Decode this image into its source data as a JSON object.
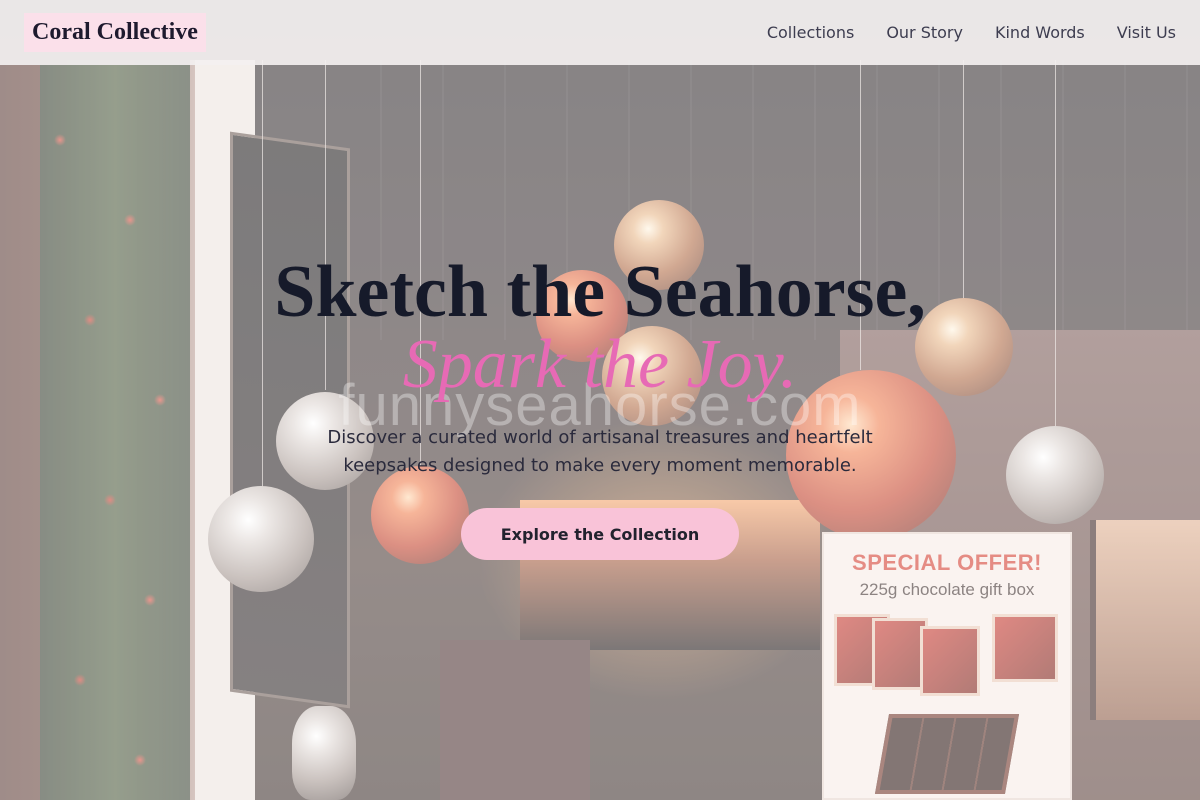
{
  "brand": {
    "name": "Coral Collective"
  },
  "nav": {
    "items": [
      "Collections",
      "Our Story",
      "Kind Words",
      "Visit Us"
    ]
  },
  "hero": {
    "title_line1": "Sketch the Seahorse,",
    "title_line2": "Spark the Joy.",
    "description": "Discover a curated world of artisanal treasures and heartfelt keepsakes designed to make every moment memorable.",
    "cta_label": "Explore the Collection"
  },
  "background": {
    "watermark": "funnyseahorse.com",
    "offer_title": "SPECIAL OFFER!",
    "offer_subtitle": "225g chocolate gift box"
  },
  "colors": {
    "accent_pink": "#e76ab5",
    "button_pink": "#f9c3d8",
    "brand_highlight": "#fbe0ea",
    "heading_dark": "#161a2a"
  }
}
